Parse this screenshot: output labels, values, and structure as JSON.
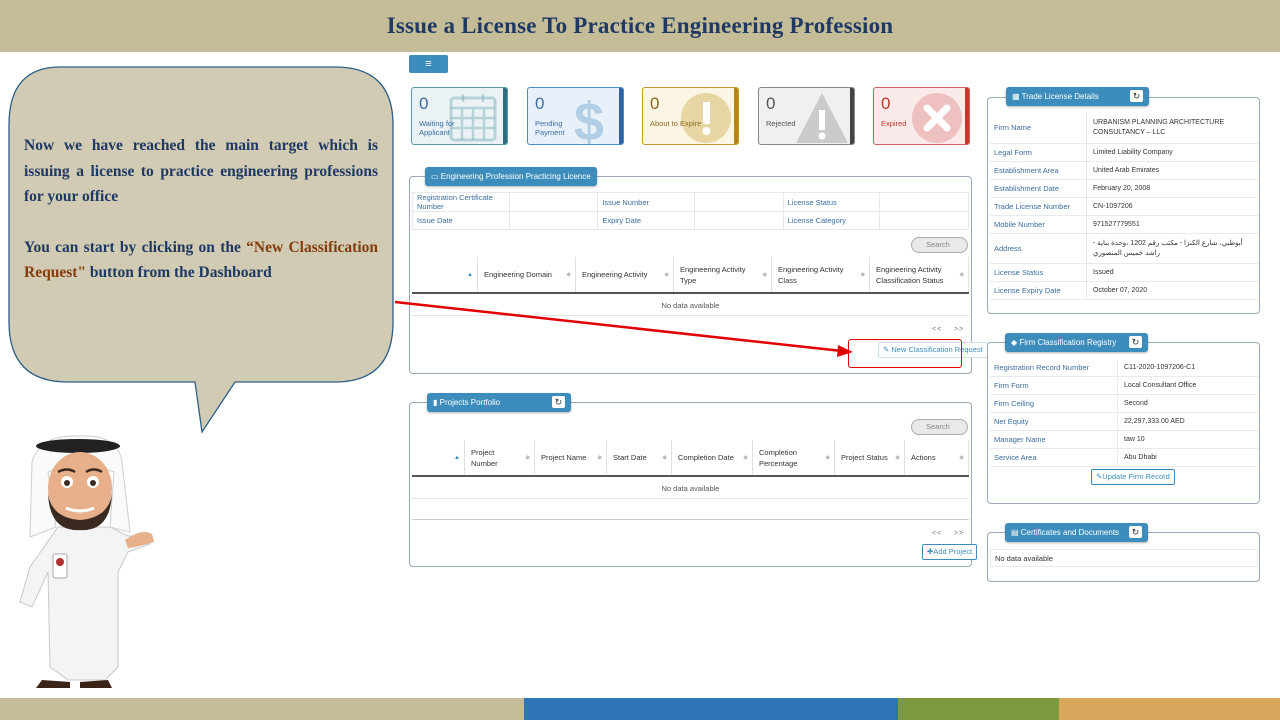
{
  "slide": {
    "title": "Issue a License To Practice Engineering Profession",
    "para1": "Now we have reached the main target which is issuing a license to practice engineering professions for your office",
    "para2_pre": "You can start by clicking on the ",
    "para2_highlight": "“New Classification Request\"",
    "para2_post": " button from the Dashboard",
    "footer_colors": [
      "#c4bd98",
      "#2e75b6",
      "#7f9a3e",
      "#d9a85c"
    ]
  },
  "colors": {
    "accent": "#3c8dbc",
    "annotation_red": "#e00000",
    "title": "#1f3864"
  },
  "menu_icon": "hamburger-icon",
  "stats": [
    {
      "value": "0",
      "label": "Waiting for\nApplicant",
      "icon": "calendar-icon",
      "bg": "#eaf2f5",
      "border": "#5a9aa8",
      "text": "#3c6da0",
      "bar": "#2a7080"
    },
    {
      "value": "0",
      "label": "Pending\nPayment",
      "icon": "dollar-icon",
      "bg": "#e8f1fa",
      "border": "#4d8ec0",
      "text": "#3c6da0",
      "bar": "#2e62a0"
    },
    {
      "value": "0",
      "label": "About to Expire",
      "icon": "exclamation-icon",
      "bg": "#fbf5e4",
      "border": "#c49a2e",
      "text": "#8a6a20",
      "bar": "#b8860b"
    },
    {
      "value": "0",
      "label": "Rejected",
      "icon": "warning-icon",
      "bg": "#f0f0f0",
      "border": "#888",
      "text": "#555",
      "bar": "#444"
    },
    {
      "value": "0",
      "label": "Expired",
      "icon": "x-circle-icon",
      "bg": "#fbeaea",
      "border": "#d06060",
      "text": "#c0392b",
      "bar": "#c0392b"
    }
  ],
  "licence_panel": {
    "title": "Engineering Profession Practicing Licence",
    "fields": [
      [
        "Registration Certificate Number",
        "",
        "Issue Number",
        "",
        "License Status",
        ""
      ],
      [
        "Issue Date",
        "",
        "Expiry Date",
        "",
        "License Category",
        ""
      ]
    ],
    "search_placeholder": "Search",
    "columns": [
      "Engineering Domain",
      "Engineering Activity",
      "Engineering Activity Type",
      "Engineering Activity Class",
      "Engineering Activity Classification Status"
    ],
    "no_data": "No data available",
    "pager_prev": "<<",
    "pager_next": ">>",
    "new_button": "New Classification Request"
  },
  "projects_panel": {
    "title": "Projects Portfolio",
    "search_placeholder": "Search",
    "columns": [
      "Project Number",
      "Project Name",
      "Start Date",
      "Completion Date",
      "Completion Percentage",
      "Project Status",
      "Actions"
    ],
    "no_data": "No data available",
    "pager_prev": "<<",
    "pager_next": ">>",
    "add_button": "Add Project"
  },
  "trade_license": {
    "title": "Trade License Details",
    "rows": [
      {
        "k": "Firm Name",
        "v": "URBANISM PLANNING ARCHITECTURE CONSULTANCY – LLC"
      },
      {
        "k": "Legal Form",
        "v": "Limited Liability Company"
      },
      {
        "k": "Establishment Area",
        "v": "United Arab Emirates"
      },
      {
        "k": "Establishment Date",
        "v": "February 20, 2008"
      },
      {
        "k": "Trade License Number",
        "v": "CN-1097206"
      },
      {
        "k": "Mobile Number",
        "v": "971527779551"
      },
      {
        "k": "Address",
        "v": "أبوظبي، شارع الكنزا - مكتب رقم 1202 ،وحدة بناية - راشد خميس المنصوري"
      },
      {
        "k": "License Status",
        "v": "Issued"
      },
      {
        "k": "License Expiry Date",
        "v": "October 07, 2020"
      }
    ]
  },
  "firm_registry": {
    "title": "Firm Classification Registry",
    "rows": [
      {
        "k": "Registration Record Number",
        "v": "C11-2020-1097206-C1"
      },
      {
        "k": "Firm Form",
        "v": "Local Consultant Office"
      },
      {
        "k": "Firm Ceiling",
        "v": "Second"
      },
      {
        "k": "Net Equity",
        "v": "22,297,333.00 AED"
      },
      {
        "k": "Manager Name",
        "v": "taw 10"
      },
      {
        "k": "Service Area",
        "v": "Abu Dhabi"
      }
    ],
    "update_button": "Update Firm Record"
  },
  "certificates": {
    "title": "Certificates and Documents",
    "no_data": "No data available"
  }
}
